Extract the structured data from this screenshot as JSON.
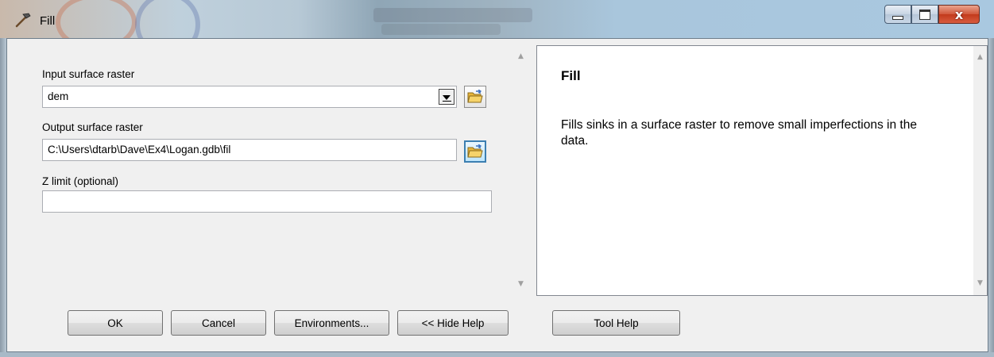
{
  "window": {
    "title": "Fill",
    "icon": "hammer-icon",
    "controls": [
      "minimize-icon",
      "maximize-icon",
      "close-icon"
    ],
    "close_glyph": "x"
  },
  "parameters": {
    "input_label": "Input surface raster",
    "input_value": "dem",
    "output_label": "Output surface raster",
    "output_value": "C:\\Users\\dtarb\\Dave\\Ex4\\Logan.gdb\\fil",
    "zlimit_label": "Z limit (optional)",
    "zlimit_value": ""
  },
  "help": {
    "title": "Fill",
    "description": "Fills sinks in a surface raster to remove small imperfections in the data."
  },
  "buttons": {
    "ok": "OK",
    "cancel": "Cancel",
    "environments": "Environments...",
    "hide_help": "<< Hide Help",
    "tool_help": "Tool Help"
  },
  "colors": {
    "close_button": "#c23a1c",
    "folder": "#f0c040",
    "active_browse_border": "#3c7fb1"
  }
}
